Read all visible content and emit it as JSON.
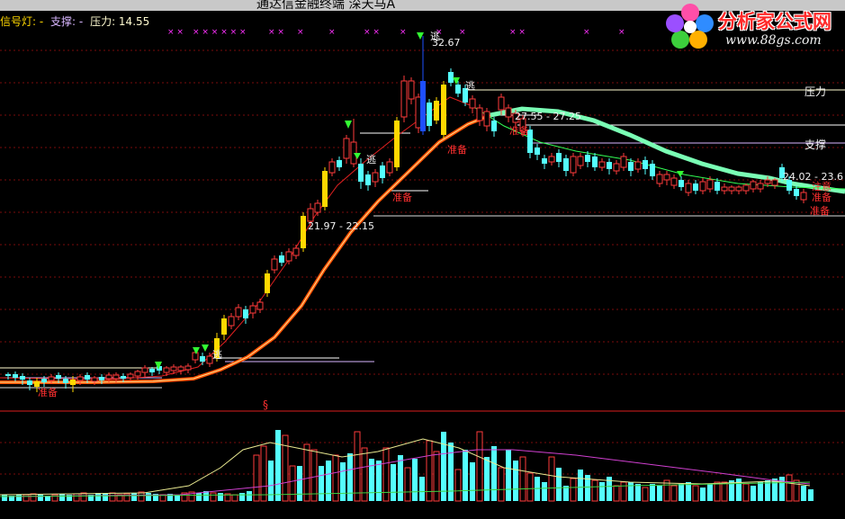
{
  "window": {
    "title": "通达信金融终端  深天马A"
  },
  "indicator_bar": {
    "light_label": "信号灯: -",
    "support_label": "支撑: -",
    "pressure_label": "压力: 14.55"
  },
  "logo": {
    "title": "分析家公式网",
    "url": "www.88gs.com"
  },
  "chart_labels": {
    "peak_price": "32.67",
    "range_top": "27.55 - 27.25",
    "range_mid": "21.97 - 22.15",
    "range_right": "24.02 - 23.6",
    "pressure_tag": "压力",
    "support_tag": "支撑",
    "escape_1": "逃",
    "escape_2": "逃",
    "escape_3": "逃",
    "escape_4": "逃",
    "prepare_1": "准备",
    "prepare_2": "准备",
    "prepare_3": "准备",
    "prepare_4": "准备",
    "prepare_5": "准备",
    "right_tag_1": "注意",
    "right_tag_2": "准备",
    "volume_marker": "§"
  },
  "colors": {
    "background": "#000000",
    "up_candle": "#ff3b3b",
    "down_candle": "#54ffff",
    "signal_candle": "#ffd800",
    "blue_candle": "#1e4fff",
    "ma_slow": "#ff5a00",
    "ma_trend": "#7affb5",
    "grid_line": "#8a1010",
    "magenta_marker": "#ff30ff",
    "green_arrow": "#33ff33"
  }
}
